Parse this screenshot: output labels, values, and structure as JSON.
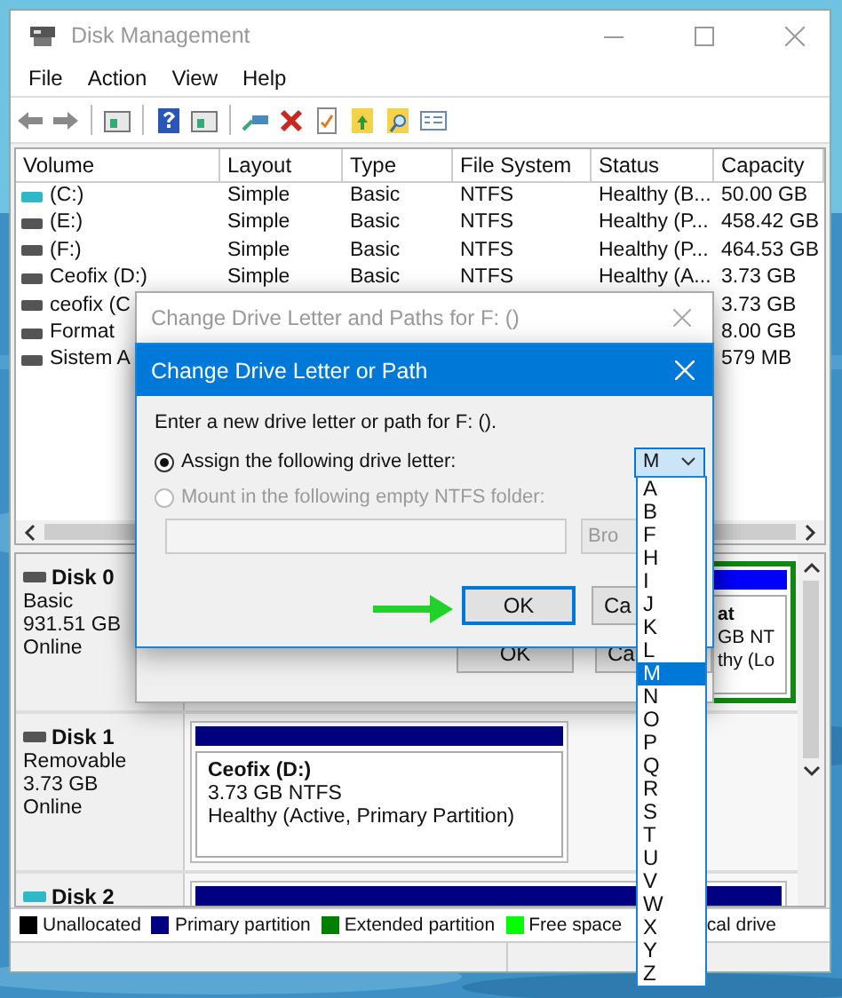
{
  "window": {
    "title": "Disk Management"
  },
  "menu": [
    "File",
    "Action",
    "View",
    "Help"
  ],
  "table": {
    "columns": [
      "Volume",
      "Layout",
      "Type",
      "File System",
      "Status",
      "Capacity"
    ],
    "rows": [
      {
        "kind": "system",
        "volume": "(C:)",
        "layout": "Simple",
        "type": "Basic",
        "file_system": "NTFS",
        "status": "Healthy (B...",
        "capacity": "50.00 GB"
      },
      {
        "kind": "drive",
        "volume": "(E:)",
        "layout": "Simple",
        "type": "Basic",
        "file_system": "NTFS",
        "status": "Healthy (P...",
        "capacity": "458.42 GB"
      },
      {
        "kind": "drive",
        "volume": "(F:)",
        "layout": "Simple",
        "type": "Basic",
        "file_system": "NTFS",
        "status": "Healthy (P...",
        "capacity": "464.53 GB"
      },
      {
        "kind": "drive",
        "volume": "Ceofix (D:)",
        "layout": "Simple",
        "type": "Basic",
        "file_system": "NTFS",
        "status": "Healthy (A...",
        "capacity": "3.73 GB"
      },
      {
        "kind": "drive",
        "volume": "ceofix (C",
        "capacity": "3.73 GB"
      },
      {
        "kind": "drive",
        "volume": "Format",
        "capacity": "8.00 GB"
      },
      {
        "kind": "drive",
        "volume": "Sistem A",
        "capacity": "579 MB"
      }
    ]
  },
  "disks": [
    {
      "kind": "hdd",
      "name": "Disk 0",
      "lines": [
        "Basic",
        "931.51 GB",
        "Online"
      ],
      "partitions": [
        {
          "kind": "logical",
          "title": "at",
          "lines": [
            "GB NT",
            "thy (Lo"
          ]
        }
      ]
    },
    {
      "kind": "hdd",
      "name": "Disk 1",
      "lines": [
        "Removable",
        "3.73 GB",
        "Online"
      ],
      "partitions": [
        {
          "kind": "primary",
          "title": "Ceofix  (D:)",
          "lines": [
            "3.73 GB NTFS",
            "Healthy (Active, Primary Partition)"
          ]
        }
      ]
    },
    {
      "kind": "usb",
      "name": "Disk 2",
      "partitions": [
        {
          "kind": "primary"
        }
      ]
    }
  ],
  "legend": [
    {
      "label": "Unallocated",
      "color": "#000000"
    },
    {
      "label": "Primary partition",
      "color": "#000080"
    },
    {
      "label": "Extended partition",
      "color": "#008000"
    },
    {
      "label": "Free space",
      "color": "#00ff00"
    },
    {
      "label": "cal drive"
    }
  ],
  "outer_dialog": {
    "title": "Change Drive Letter and Paths for F: ()",
    "buttons": [
      "OK",
      "Ca"
    ]
  },
  "dialog": {
    "title": "Change Drive Letter or Path",
    "prompt": "Enter a new drive letter or path for F: ().",
    "options": [
      {
        "label": "Assign the following drive letter:",
        "selected": true,
        "disabled": false
      },
      {
        "label": "Mount in the following empty NTFS folder:",
        "selected": false,
        "disabled": true
      }
    ],
    "letter": {
      "value": "M",
      "items": [
        {
          "label": "A",
          "selected": false
        },
        {
          "label": "B",
          "selected": false
        },
        {
          "label": "F",
          "selected": false
        },
        {
          "label": "H",
          "selected": false
        },
        {
          "label": "I",
          "selected": false
        },
        {
          "label": "J",
          "selected": false
        },
        {
          "label": "K",
          "selected": false
        },
        {
          "label": "L",
          "selected": false
        },
        {
          "label": "M",
          "selected": true
        },
        {
          "label": "N",
          "selected": false
        },
        {
          "label": "O",
          "selected": false
        },
        {
          "label": "P",
          "selected": false
        },
        {
          "label": "Q",
          "selected": false
        },
        {
          "label": "R",
          "selected": false
        },
        {
          "label": "S",
          "selected": false
        },
        {
          "label": "T",
          "selected": false
        },
        {
          "label": "U",
          "selected": false
        },
        {
          "label": "V",
          "selected": false
        },
        {
          "label": "W",
          "selected": false
        },
        {
          "label": "X",
          "selected": false
        },
        {
          "label": "Y",
          "selected": false
        },
        {
          "label": "Z",
          "selected": false
        }
      ]
    },
    "browse": {
      "label": "Bro",
      "disabled": true
    },
    "buttons": [
      {
        "label": "OK",
        "focused": true
      },
      {
        "label": "Ca",
        "focused": false
      }
    ]
  }
}
